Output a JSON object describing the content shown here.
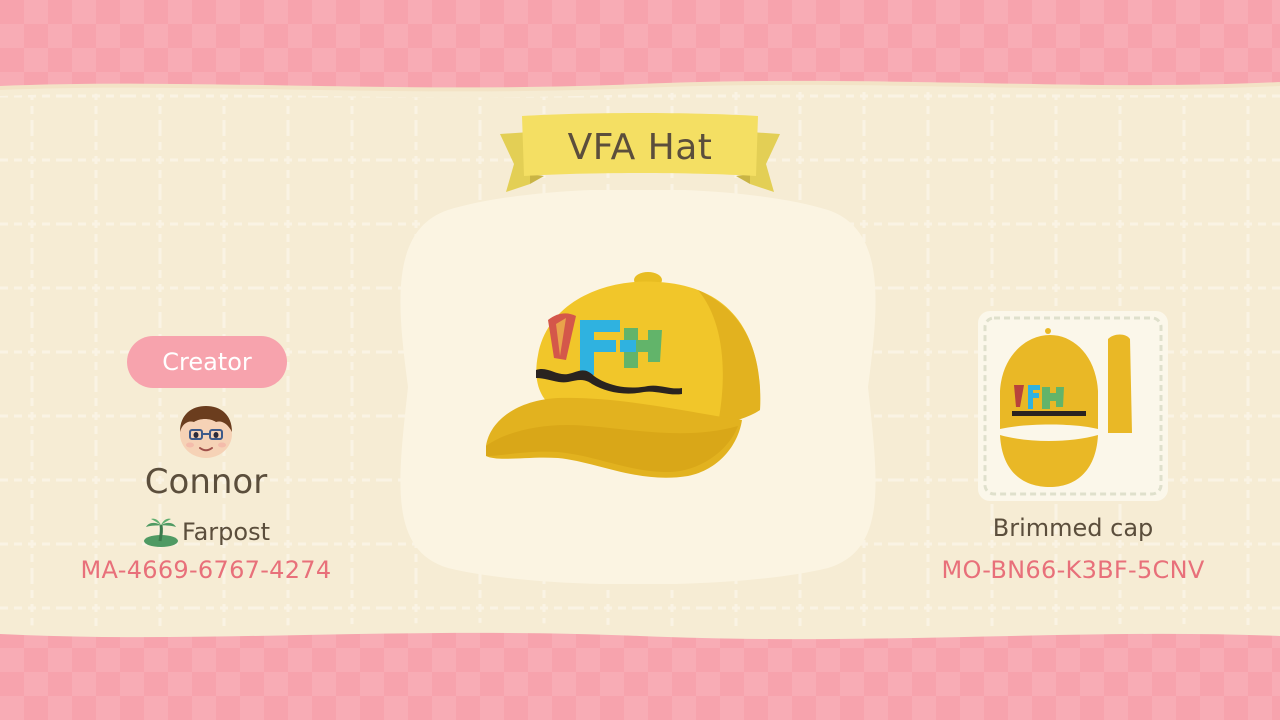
{
  "design": {
    "title": "VFA Hat",
    "item_type": "Brimmed cap",
    "design_code": "MO-BN66-K3BF-5CNV"
  },
  "creator": {
    "badge_label": "Creator",
    "name": "Connor",
    "island": "Farpost",
    "creator_code": "MA-4669-6767-4274"
  },
  "colors": {
    "pink_background": "#f7a3ad",
    "cream_panel": "#f6ecd4",
    "banner_yellow": "#f4df63",
    "hat_yellow": "#f1c62a",
    "code_pink": "#e8707a",
    "text_brown": "#5b4e3c"
  },
  "icons": {
    "island": "palm-tree-island-icon",
    "avatar": "villager-face-icon"
  }
}
